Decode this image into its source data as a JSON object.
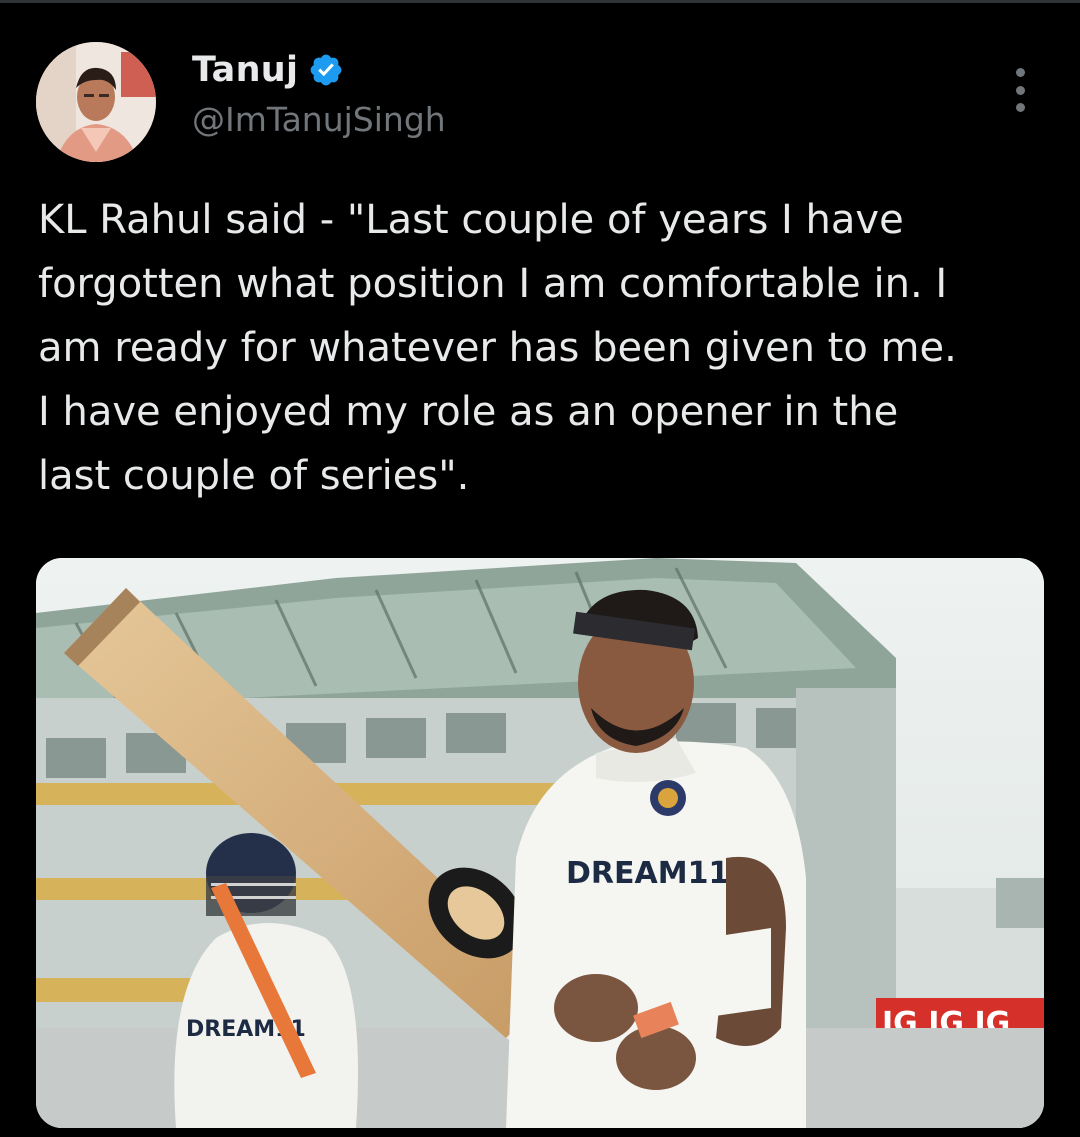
{
  "tweet": {
    "author": {
      "name": "Tanuj",
      "handle": "@ImTanujSingh",
      "verified": true,
      "avatar_icon": "profile-photo"
    },
    "more_icon": "more-options-icon",
    "text": "KL Rahul said - \"Last couple of years I have\nforgotten what position I am comfortable in. I\nam ready for whatever has been given to me.\nI have enjoyed my role as an opener in the\nlast couple of series\".",
    "media": {
      "description_icon": "photo-cricketer-with-bat",
      "jersey_text_main": "DREAM11",
      "jersey_text_secondary": "DREAM11",
      "hoarding_text": "IG IG IG"
    }
  },
  "colors": {
    "background": "#000000",
    "text_primary": "#e7e9ea",
    "text_secondary": "#71767b",
    "verified_blue": "#1d9bf0"
  }
}
